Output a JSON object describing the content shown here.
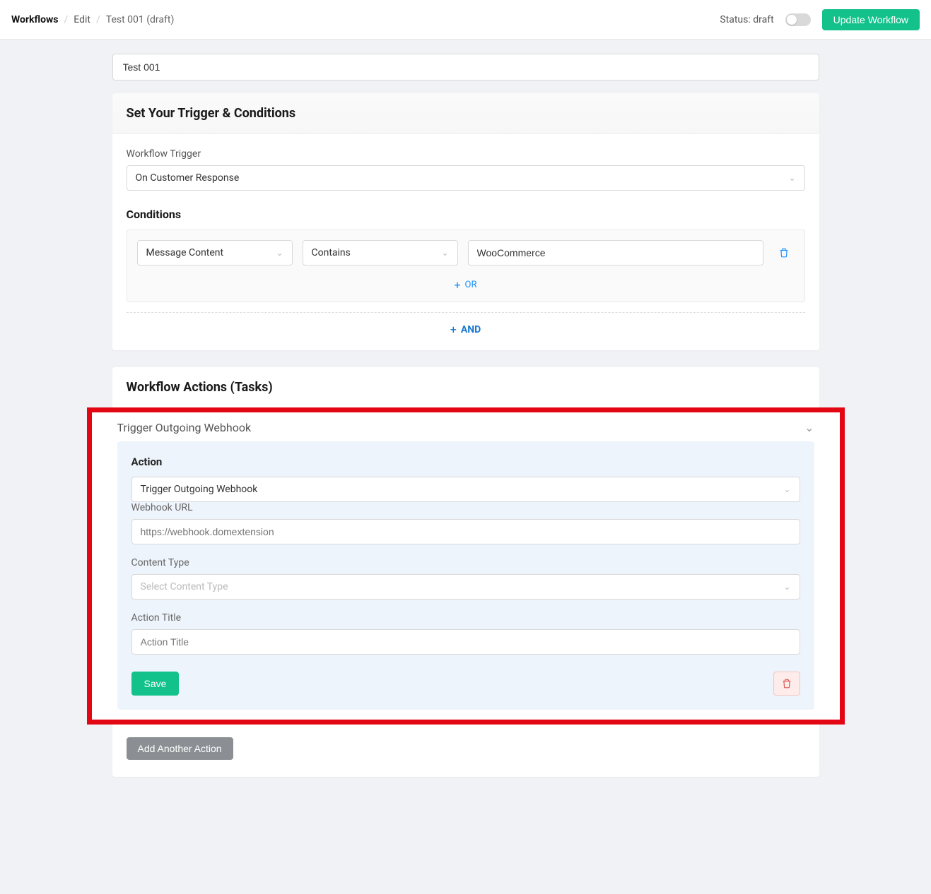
{
  "breadcrumb": {
    "root": "Workflows",
    "edit": "Edit",
    "current": "Test 001 (draft)"
  },
  "header": {
    "status_label": "Status: draft",
    "update_btn": "Update Workflow"
  },
  "workflow_name": "Test 001",
  "trigger_section": {
    "title": "Set Your Trigger & Conditions",
    "trigger_label": "Workflow Trigger",
    "trigger_value": "On Customer Response",
    "conditions_title": "Conditions",
    "condition_field": "Message Content",
    "condition_op": "Contains",
    "condition_value": "WooCommerce",
    "or_label": "OR",
    "and_label": "AND"
  },
  "actions_section": {
    "title": "Workflow Actions (Tasks)",
    "panel_title": "Trigger Outgoing Webhook",
    "action_heading": "Action",
    "action_value": "Trigger Outgoing Webhook",
    "webhook_label": "Webhook URL",
    "webhook_placeholder": "https://webhook.domextension",
    "content_type_label": "Content Type",
    "content_type_placeholder": "Select Content Type",
    "action_title_label": "Action Title",
    "action_title_placeholder": "Action Title",
    "save_btn": "Save",
    "add_action_btn": "Add Another Action"
  }
}
